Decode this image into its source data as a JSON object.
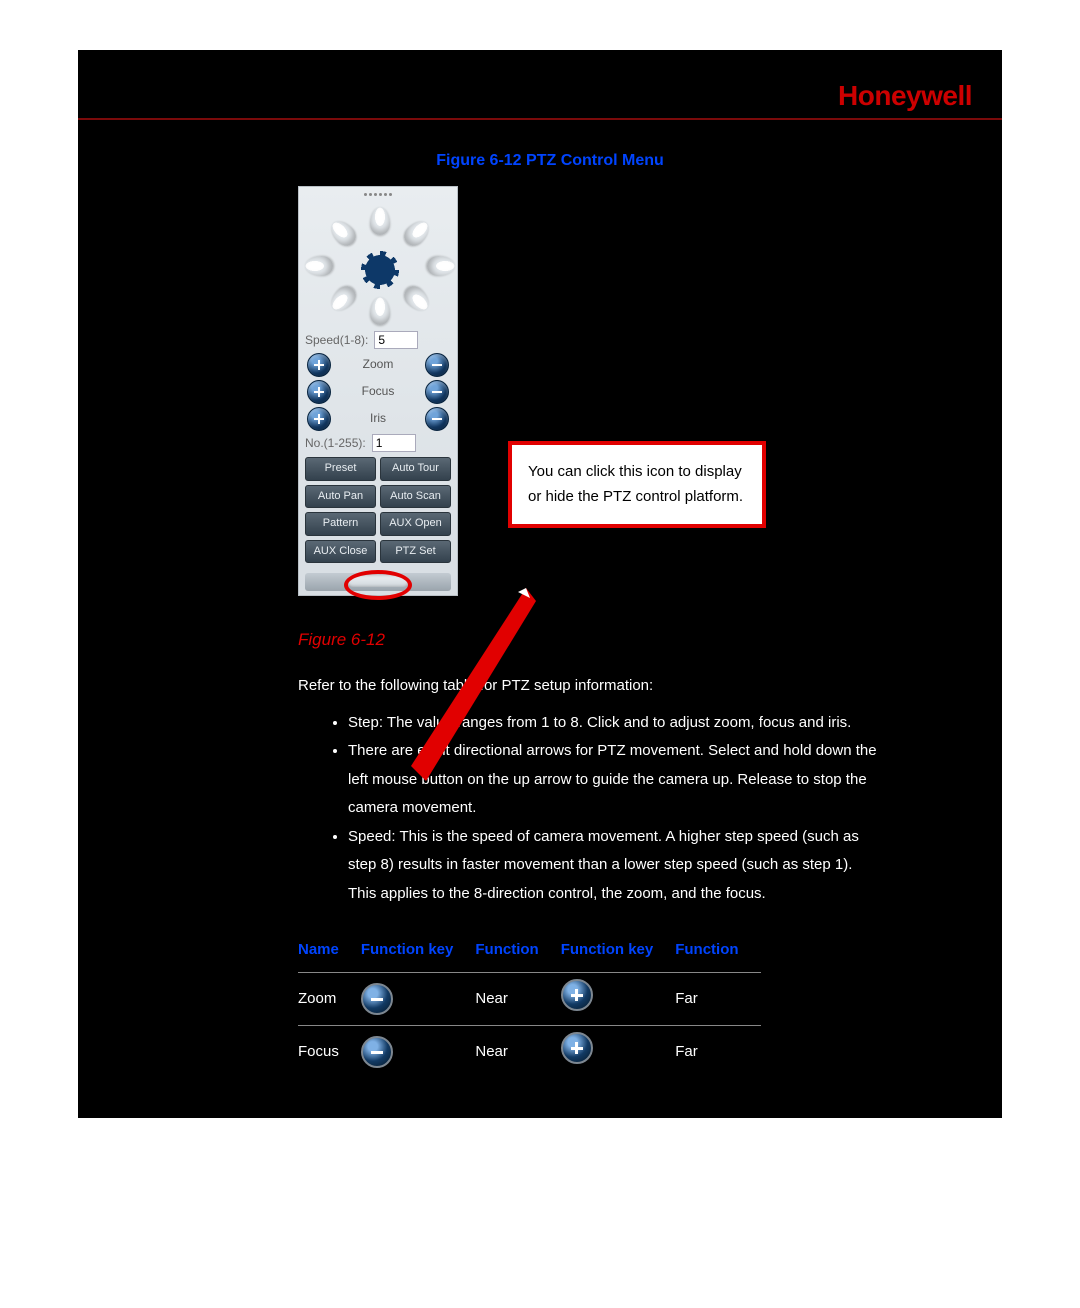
{
  "brand": "Honeywell",
  "figure_title": "Figure 6-12 PTZ Control Menu",
  "figure_label": "Figure 6-12",
  "ptz": {
    "speed_label": "Speed(1-8):",
    "speed_value": "5",
    "controls": [
      {
        "label": "Zoom"
      },
      {
        "label": "Focus"
      },
      {
        "label": "Iris"
      }
    ],
    "no_label": "No.(1-255):",
    "no_value": "1",
    "buttons": [
      "Preset",
      "Auto Tour",
      "Auto Pan",
      "Auto Scan",
      "Pattern",
      "AUX Open",
      "AUX Close",
      "PTZ Set"
    ]
  },
  "callout_text": "You can click this icon to display or hide the PTZ control platform.",
  "body": {
    "intro": "Refer to the following table for PTZ setup information:",
    "bullets": [
      "Step: The value ranges from 1 to 8. Click     and     to adjust zoom, focus and iris.",
      "There are eight directional arrows for PTZ movement. Select and hold down the left mouse button on the up arrow to guide the camera up. Release to stop the camera movement.",
      "Speed: This is the speed of camera movement. A higher step speed (such as step 8) results in faster movement than a lower step speed (such as step 1). This applies to the 8-direction control, the zoom, and the focus."
    ]
  },
  "table": {
    "headers": [
      "Name",
      "Function key",
      "Function",
      "Function key",
      "Function"
    ],
    "rows": [
      {
        "name": "Zoom",
        "f1": "Near",
        "f2": "Far"
      },
      {
        "name": "Focus",
        "f1": "Near",
        "f2": "Far"
      }
    ]
  }
}
